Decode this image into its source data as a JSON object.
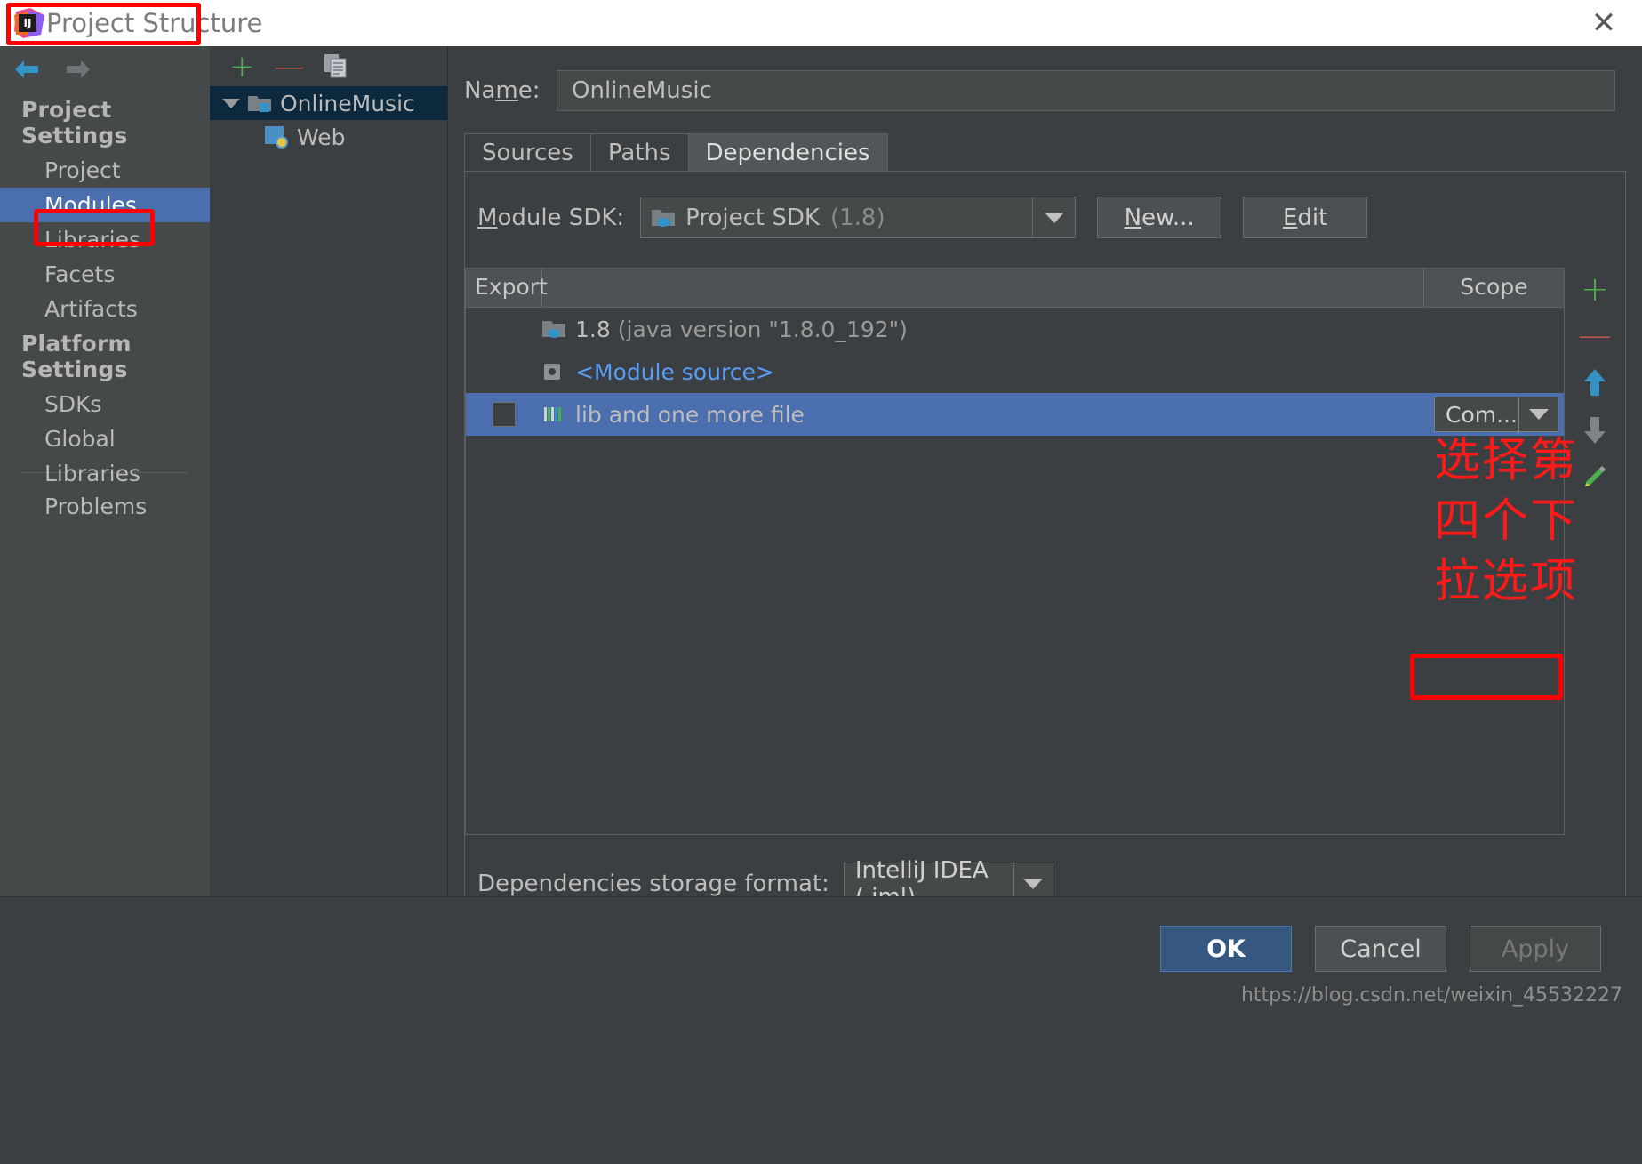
{
  "window": {
    "title": "Project Structure",
    "logo_icon": "intellij-idea-logo",
    "close_icon": "close-icon"
  },
  "sidebar": {
    "back_icon": "back-arrow-icon",
    "forward_icon": "forward-arrow-icon",
    "groups": [
      {
        "label": "Project Settings",
        "items": [
          {
            "label": "Project",
            "selected": false
          },
          {
            "label": "Modules",
            "selected": true
          },
          {
            "label": "Libraries",
            "selected": false
          },
          {
            "label": "Facets",
            "selected": false
          },
          {
            "label": "Artifacts",
            "selected": false
          }
        ]
      },
      {
        "label": "Platform Settings",
        "items": [
          {
            "label": "SDKs",
            "selected": false
          },
          {
            "label": "Global Libraries",
            "selected": false
          }
        ]
      }
    ],
    "extra_items": [
      {
        "label": "Problems",
        "selected": false
      }
    ]
  },
  "tree_panel": {
    "toolbar": {
      "add_label": "+",
      "remove_label": "—",
      "copy_icon": "copy-icon"
    },
    "nodes": [
      {
        "label": "OnlineMusic",
        "icon": "module-folder-icon",
        "selected": true,
        "expanded": true
      },
      {
        "label": "Web",
        "icon": "web-facet-icon",
        "selected": false
      }
    ]
  },
  "main": {
    "name_label": "Name:",
    "name_value": "OnlineMusic",
    "tabs": [
      {
        "label": "Sources",
        "active": false
      },
      {
        "label": "Paths",
        "active": false
      },
      {
        "label": "Dependencies",
        "active": true
      }
    ],
    "sdk": {
      "label": "Module SDK:",
      "value_primary": "Project SDK",
      "value_secondary": "(1.8)",
      "icon": "java-sdk-icon",
      "dropdown_icon": "chevron-down-icon",
      "new_button": "New...",
      "edit_button": "Edit"
    },
    "table": {
      "columns": [
        "Export",
        "Scope"
      ],
      "rows": [
        {
          "export_checked": false,
          "has_checkbox": false,
          "icon": "java-sdk-icon",
          "name_primary": "1.8",
          "name_secondary": "(java version \"1.8.0_192\")",
          "scope": "",
          "selected": false
        },
        {
          "export_checked": false,
          "has_checkbox": false,
          "icon": "module-source-icon",
          "name_primary": "<Module source>",
          "name_secondary": "",
          "scope": "",
          "selected": false
        },
        {
          "export_checked": false,
          "has_checkbox": true,
          "icon": "library-icon",
          "name_primary": "lib and one more file",
          "name_secondary": "",
          "scope": "Com...",
          "selected": true
        }
      ]
    },
    "actions": [
      {
        "name": "add",
        "icon": "plus-icon",
        "label": "+"
      },
      {
        "name": "remove",
        "icon": "minus-icon",
        "label": "—"
      },
      {
        "name": "move-up",
        "icon": "arrow-up-icon",
        "label": ""
      },
      {
        "name": "move-down",
        "icon": "arrow-down-icon",
        "label": ""
      },
      {
        "name": "edit",
        "icon": "pencil-icon",
        "label": ""
      }
    ],
    "storage": {
      "label": "Dependencies storage format:",
      "value": "IntelliJ IDEA (.iml)",
      "dropdown_icon": "chevron-down-icon"
    }
  },
  "annotation": {
    "text": "选择第四个下拉选项",
    "color": "#ff1a1a"
  },
  "footer": {
    "ok_label": "OK",
    "cancel_label": "Cancel",
    "apply_label": "Apply",
    "watermark": "https://blog.csdn.net/weixin_45532227"
  },
  "colors": {
    "selection_blue": "#4b6eaf",
    "tree_selection": "#0d293e",
    "accent_red": "#ff0000",
    "link_blue": "#589df6",
    "panel_bg": "#3c3f41",
    "sidebar_bg": "#45494a"
  }
}
